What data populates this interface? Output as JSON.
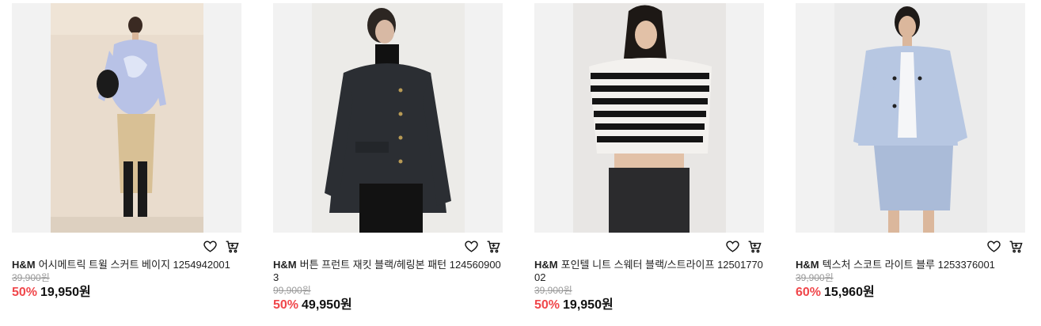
{
  "colors": {
    "discount": "#f0474b",
    "original_price": "#999999",
    "thumb_bg": "#f2f2f2"
  },
  "products": [
    {
      "brand": "H&M",
      "name": "어시메트릭 트윌 스커트 베이지 1254942001",
      "original_price": "39,900원",
      "discount": "50%",
      "price": "19,950원"
    },
    {
      "brand": "H&M",
      "name": "버튼 프런트 재킷 블랙/헤링본 패턴 1245609003",
      "original_price": "99,900원",
      "discount": "50%",
      "price": "49,950원"
    },
    {
      "brand": "H&M",
      "name": "포인텔 니트 스웨터 블랙/스트라이프 1250177002",
      "original_price": "39,900원",
      "discount": "50%",
      "price": "19,950원"
    },
    {
      "brand": "H&M",
      "name": "텍스처 스코트 라이트 블루 1253376001",
      "original_price": "39,900원",
      "discount": "60%",
      "price": "15,960원"
    }
  ]
}
